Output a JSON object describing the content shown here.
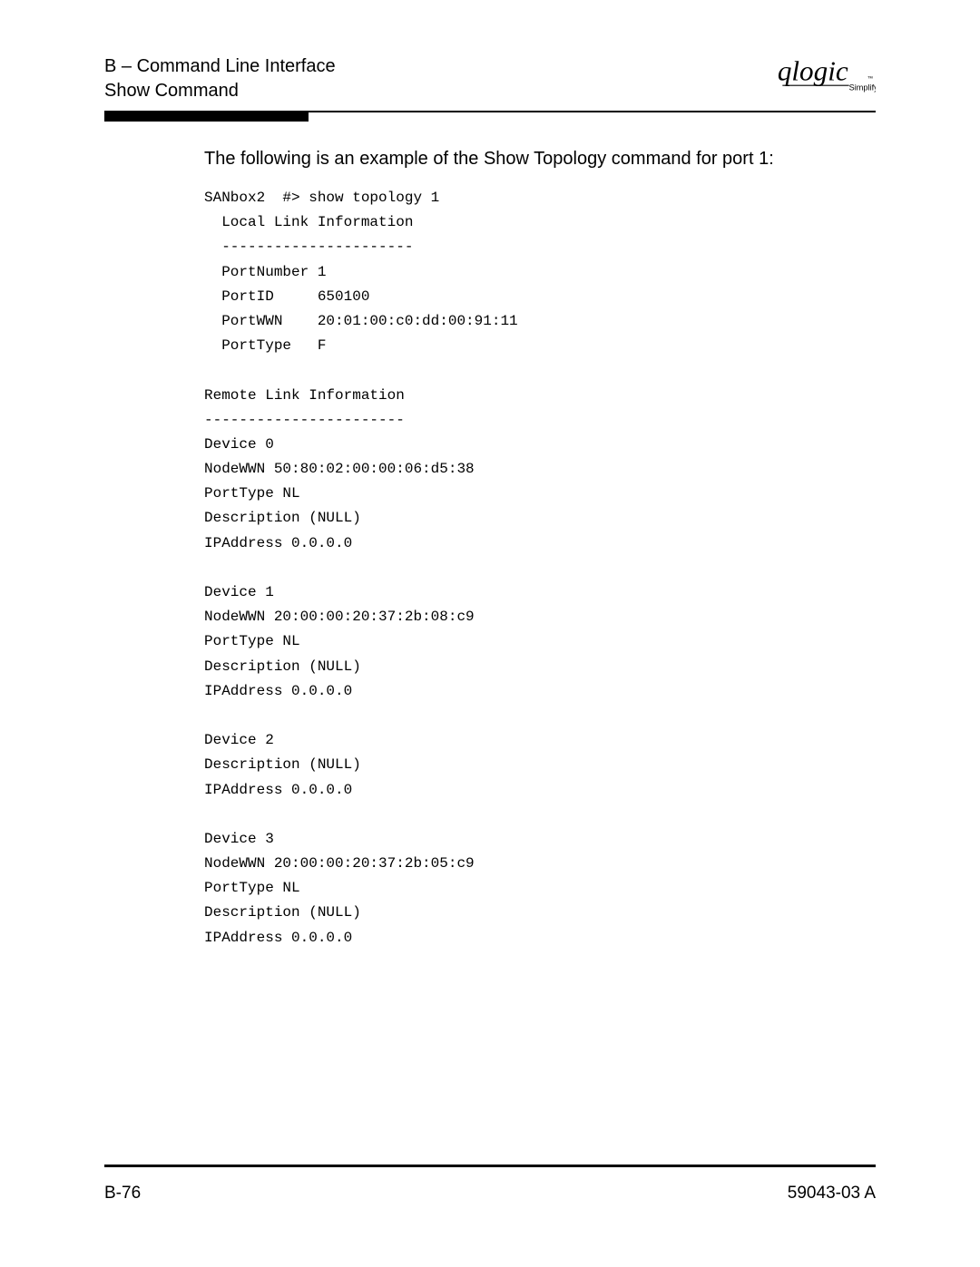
{
  "header": {
    "section_line1": "B – Command Line Interface",
    "section_line2": "Show Command",
    "logo_main": "qlogic",
    "logo_sub": "Simplify",
    "logo_tm": "™"
  },
  "content": {
    "intro": "The following is an example of the Show Topology command for port 1:",
    "code": "SANbox2  #> show topology 1\n  Local Link Information\n  ----------------------\n  PortNumber 1\n  PortID     650100\n  PortWWN    20:01:00:c0:dd:00:91:11\n  PortType   F\n\nRemote Link Information\n-----------------------\nDevice 0\nNodeWWN 50:80:02:00:00:06:d5:38\nPortType NL\nDescription (NULL)\nIPAddress 0.0.0.0\n\nDevice 1\nNodeWWN 20:00:00:20:37:2b:08:c9\nPortType NL\nDescription (NULL)\nIPAddress 0.0.0.0\n\nDevice 2\nDescription (NULL)\nIPAddress 0.0.0.0\n\nDevice 3\nNodeWWN 20:00:00:20:37:2b:05:c9\nPortType NL\nDescription (NULL)\nIPAddress 0.0.0.0"
  },
  "footer": {
    "page_number": "B-76",
    "doc_id": "59043-03  A"
  }
}
